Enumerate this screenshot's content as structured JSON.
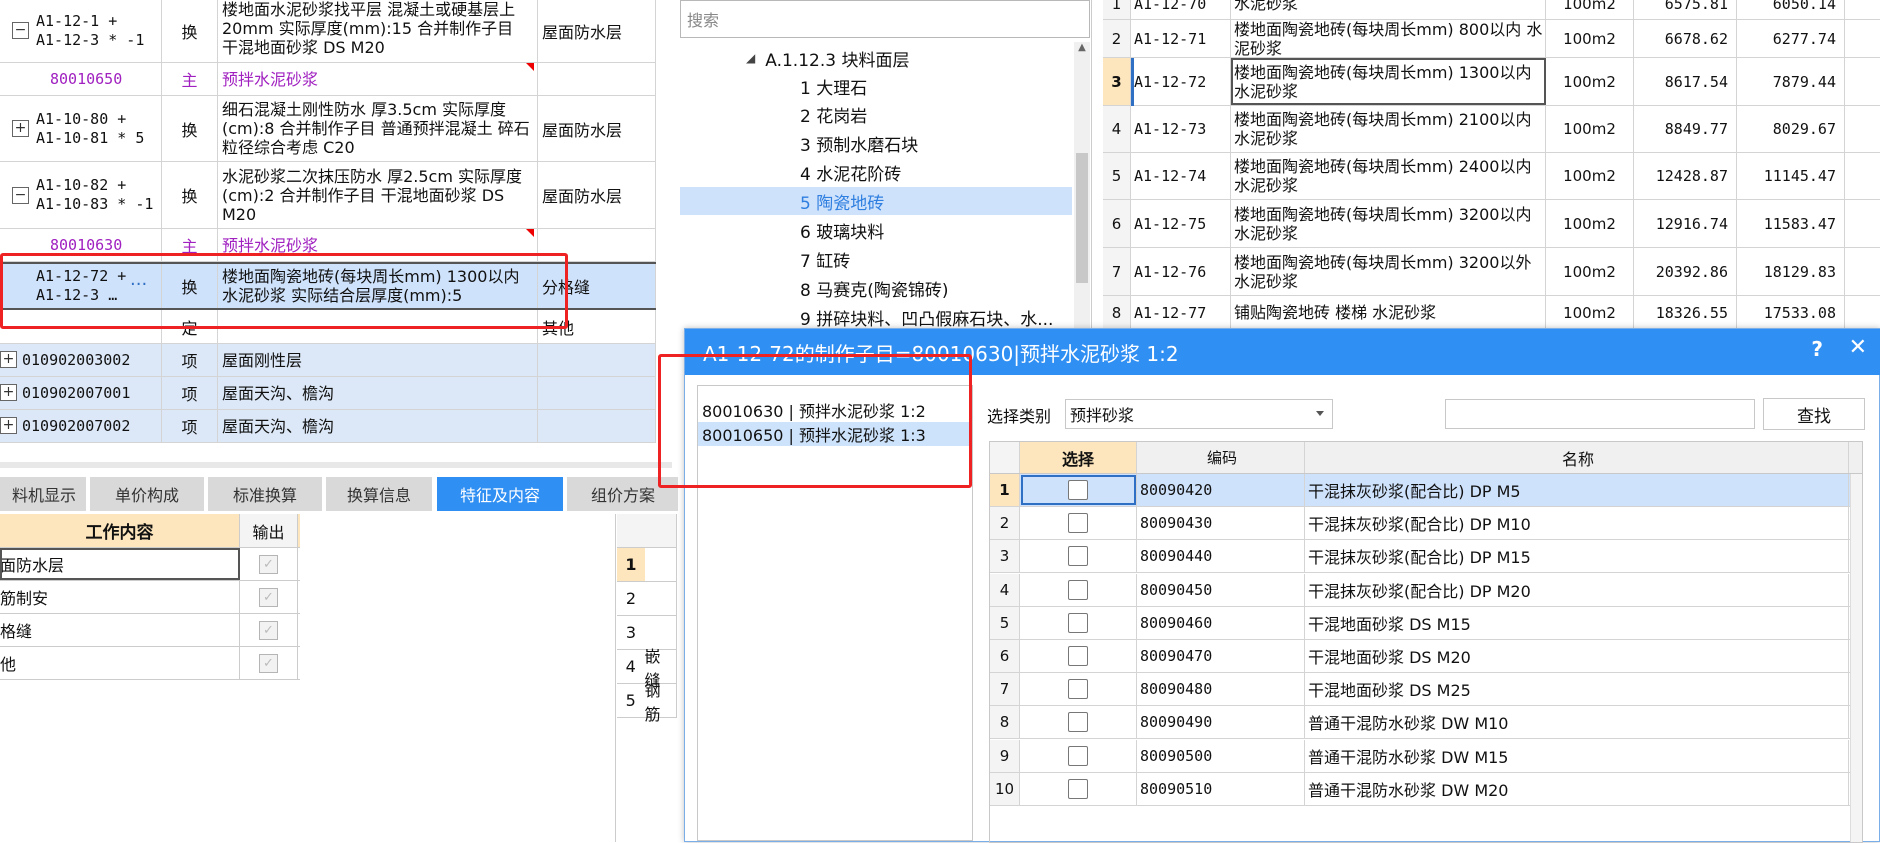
{
  "main_grid": {
    "rows": [
      {
        "code": "A1-12-1 +\nA1-12-3 * -1",
        "type": "换",
        "name": "楼地面水泥砂浆找平层 混凝土或硬基层上 20mm 实际厚度(mm):15 合并制作子目 干混地面砂浆 DS M20",
        "feature": "屋面防水层",
        "expander": "−"
      },
      {
        "code": "80010650",
        "type": "主",
        "name": "预拌水泥砂浆",
        "feature": ""
      },
      {
        "code": "A1-10-80 +\nA1-10-81 * 5",
        "type": "换",
        "name": "细石混凝土刚性防水 厚3.5cm 实际厚度(cm):8 合并制作子目 普通预拌混凝土 碎石粒径综合考虑 C20",
        "feature": "屋面防水层",
        "expander": "+"
      },
      {
        "code": "A1-10-82 +\nA1-10-83 * -1",
        "type": "换",
        "name": "水泥砂浆二次抹压防水 厚2.5cm 实际厚度(cm):2 合并制作子目 干混地面砂浆 DS M20",
        "feature": "屋面防水层",
        "expander": "−"
      },
      {
        "code": "80010630",
        "type": "主",
        "name": "预拌水泥砂浆",
        "feature": ""
      },
      {
        "code": "A1-12-72 +\nA1-12-3 …",
        "type": "换",
        "name": "楼地面陶瓷地砖(每块周长mm) 1300以内 水泥砂浆 实际结合层厚度(mm):5",
        "feature": "分格缝",
        "more": "···"
      },
      {
        "code": "",
        "type": "定",
        "name": "",
        "feature": "其他"
      },
      {
        "code": "010902003002",
        "type": "项",
        "name": "屋面刚性层",
        "feature": "",
        "expander": "+"
      },
      {
        "code": "010902007001",
        "type": "项",
        "name": "屋面天沟、檐沟",
        "feature": "",
        "expander": "+"
      },
      {
        "code": "010902007002",
        "type": "项",
        "name": "屋面天沟、檐沟",
        "feature": "",
        "expander": "+"
      }
    ]
  },
  "bottom_tabs": [
    "料机显示",
    "单价构成",
    "标准换算",
    "换算信息",
    "特征及内容",
    "组价方案"
  ],
  "work_table": {
    "headers": [
      "工作内容",
      "输出"
    ],
    "rows": [
      "面防水层",
      "筋制安",
      "格缝",
      "他"
    ]
  },
  "mini_table": {
    "rows": [
      {
        "idx": "1",
        "text": ""
      },
      {
        "idx": "2",
        "text": ""
      },
      {
        "idx": "3",
        "text": ""
      },
      {
        "idx": "4",
        "text": "嵌缝"
      },
      {
        "idx": "5",
        "text": "钢筋"
      }
    ]
  },
  "tree": {
    "search_placeholder": "搜索",
    "parent": "A.1.12.3 块料面层",
    "items": [
      "1 大理石",
      "2 花岗岩",
      "3 预制水磨石块",
      "4 水泥花阶砖",
      "5 陶瓷地砖",
      "6 玻璃块料",
      "7 缸砖",
      "8 马赛克(陶瓷锦砖)",
      "9 拼碎块料、凹凸假麻石块、水..."
    ],
    "selected_index": 4
  },
  "quota_table": {
    "rows": [
      {
        "idx": "1",
        "code": "A1-12-70",
        "name": "水泥砂浆",
        "unit": "100m2",
        "p1": "6575.81",
        "p2": "6050.14"
      },
      {
        "idx": "2",
        "code": "A1-12-71",
        "name": "楼地面陶瓷地砖(每块周长mm) 800以内 水泥砂浆",
        "unit": "100m2",
        "p1": "6678.62",
        "p2": "6277.74"
      },
      {
        "idx": "3",
        "code": "A1-12-72",
        "name": "楼地面陶瓷地砖(每块周长mm) 1300以内 水泥砂浆",
        "unit": "100m2",
        "p1": "8617.54",
        "p2": "7879.44"
      },
      {
        "idx": "4",
        "code": "A1-12-73",
        "name": "楼地面陶瓷地砖(每块周长mm) 2100以内 水泥砂浆",
        "unit": "100m2",
        "p1": "8849.77",
        "p2": "8029.67"
      },
      {
        "idx": "5",
        "code": "A1-12-74",
        "name": "楼地面陶瓷地砖(每块周长mm) 2400以内 水泥砂浆",
        "unit": "100m2",
        "p1": "12428.87",
        "p2": "11145.47"
      },
      {
        "idx": "6",
        "code": "A1-12-75",
        "name": "楼地面陶瓷地砖(每块周长mm) 3200以内 水泥砂浆",
        "unit": "100m2",
        "p1": "12916.74",
        "p2": "11583.47"
      },
      {
        "idx": "7",
        "code": "A1-12-76",
        "name": "楼地面陶瓷地砖(每块周长mm) 3200以外 水泥砂浆",
        "unit": "100m2",
        "p1": "20392.86",
        "p2": "18129.83"
      },
      {
        "idx": "8",
        "code": "A1-12-77",
        "name": "铺贴陶瓷地砖 楼梯 水泥砂浆",
        "unit": "100m2",
        "p1": "18326.55",
        "p2": "17533.08"
      }
    ],
    "selected_index": 2
  },
  "dialog": {
    "title": "A1-12-72的制作子目=80010630|预拌水泥砂浆 1:2",
    "help": "?",
    "close": "✕",
    "left_items": [
      "80010630 | 预拌水泥砂浆 1:2",
      "80010650 | 预拌水泥砂浆 1:3"
    ],
    "left_selected": 1,
    "category_label": "选择类别",
    "category_value": "预拌砂浆",
    "find_button": "查找",
    "table_headers": {
      "select": "选择",
      "code": "编码",
      "name": "名称"
    },
    "materials": [
      {
        "idx": "1",
        "code": "80090420",
        "name": "干混抹灰砂浆(配合比) DP M5"
      },
      {
        "idx": "2",
        "code": "80090430",
        "name": "干混抹灰砂浆(配合比) DP M10"
      },
      {
        "idx": "3",
        "code": "80090440",
        "name": "干混抹灰砂浆(配合比) DP M15"
      },
      {
        "idx": "4",
        "code": "80090450",
        "name": "干混抹灰砂浆(配合比) DP M20"
      },
      {
        "idx": "5",
        "code": "80090460",
        "name": "干混地面砂浆 DS M15"
      },
      {
        "idx": "6",
        "code": "80090470",
        "name": "干混地面砂浆 DS M20"
      },
      {
        "idx": "7",
        "code": "80090480",
        "name": "干混地面砂浆 DS M25"
      },
      {
        "idx": "8",
        "code": "80090490",
        "name": "普通干混防水砂浆 DW M10"
      },
      {
        "idx": "9",
        "code": "80090500",
        "name": "普通干混防水砂浆 DW M15"
      },
      {
        "idx": "10",
        "code": "80090510",
        "name": "普通干混防水砂浆 DW M20"
      }
    ]
  },
  "colors": {
    "accent": "#2f8ff3",
    "selection": "#cfe2fb",
    "header": "#fde6bd",
    "annotation": "#ee2222"
  }
}
